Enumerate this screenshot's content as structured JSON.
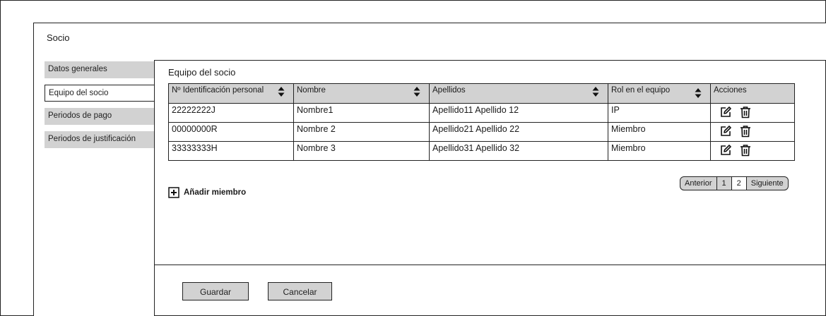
{
  "page": {
    "title": "Socio"
  },
  "side_tabs": [
    {
      "label": "Datos generales",
      "active": false
    },
    {
      "label": "Equipo del socio",
      "active": true
    },
    {
      "label": "Periodos de pago",
      "active": false
    },
    {
      "label": "Periodos de justificación",
      "active": false
    }
  ],
  "panel": {
    "title": "Equipo del socio",
    "table": {
      "headers": [
        "Nº Identificación personal",
        "Nombre",
        "Apellidos",
        "Rol en el equipo",
        "Acciones"
      ],
      "rows": [
        [
          "22222222J",
          "Nombre1",
          "Apellido11 Apellido 12",
          "IP"
        ],
        [
          "00000000R",
          "Nombre 2",
          "Apellido21 Apellido 22",
          "Miembro"
        ],
        [
          "33333333H",
          "Nombre 3",
          "Apellido31 Apellido 32",
          "Miembro"
        ]
      ]
    },
    "add_member_label": "Añadir miembro",
    "pagination": {
      "prev": "Anterior",
      "pages": [
        "1",
        "2"
      ],
      "current_page": "2",
      "next": "Siguiente"
    }
  },
  "footer": {
    "save_label": "Guardar",
    "cancel_label": "Cancelar"
  },
  "icons": {
    "sort": "sort-icon",
    "edit": "edit-icon",
    "delete": "trash-icon",
    "add": "plus-square-icon"
  },
  "colors": {
    "header_bg": "#d2d2d2",
    "border": "#222222"
  }
}
